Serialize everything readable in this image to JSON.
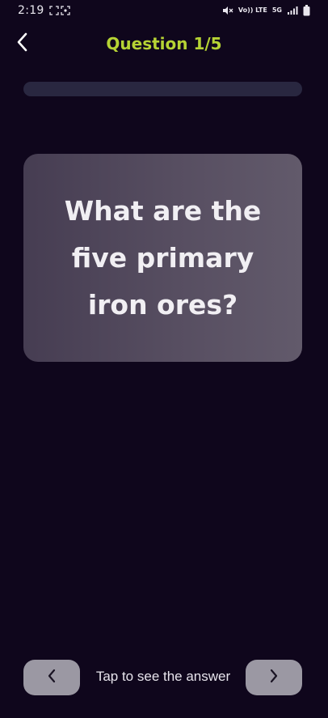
{
  "status_bar": {
    "time": "2:19",
    "screenshot_indicator_icon": "screen-capture-icon",
    "mute_icon": "mute-icon",
    "network_volte": "Vo)) LTE",
    "network_5g": "5G",
    "signal_icon": "signal-icon",
    "battery_icon": "battery-icon"
  },
  "header": {
    "title": "Question 1/5",
    "back_icon": "chevron-left-icon",
    "title_color": "#b6d334"
  },
  "progress": {
    "current": 1,
    "total": 5,
    "fill_fraction": 0,
    "track_color": "#292740"
  },
  "card": {
    "question": "What are the five primary iron ores?"
  },
  "footer": {
    "hint": "Tap to see the answer",
    "prev_icon": "chevron-left-icon",
    "next_icon": "chevron-right-icon"
  },
  "colors": {
    "background": "#0f061c",
    "card": "#574e61",
    "nav_button": "#9b98a3"
  }
}
